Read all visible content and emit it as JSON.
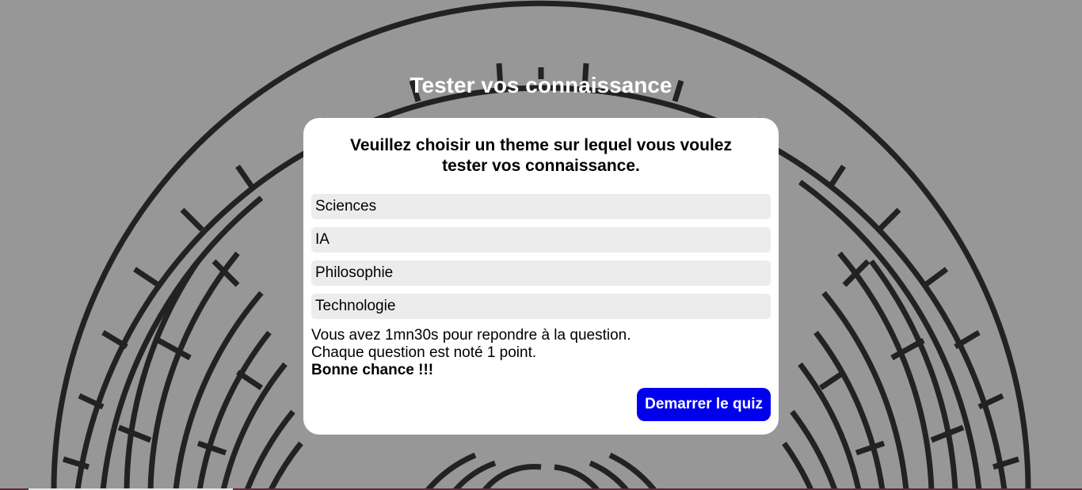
{
  "page": {
    "title": "Tester vos connaissance"
  },
  "card": {
    "heading": "Veuillez choisir un theme sur lequel vous voulez tester vos connaissance.",
    "themes": [
      {
        "label": "Sciences"
      },
      {
        "label": "IA"
      },
      {
        "label": "Philosophie"
      },
      {
        "label": "Technologie"
      }
    ],
    "info": {
      "line1": "Vous avez 1mn30s pour repondre à la question.",
      "line2": "Chaque question est noté 1 point.",
      "line3": "Bonne chance !!!"
    },
    "start_button": "Demarrer le quiz"
  },
  "colors": {
    "background": "#979797",
    "maze_lines": "#222222",
    "card": "#ffffff",
    "theme_item": "#ececec",
    "button": "#0000ee"
  },
  "icons": {
    "background": "maze-pattern"
  }
}
